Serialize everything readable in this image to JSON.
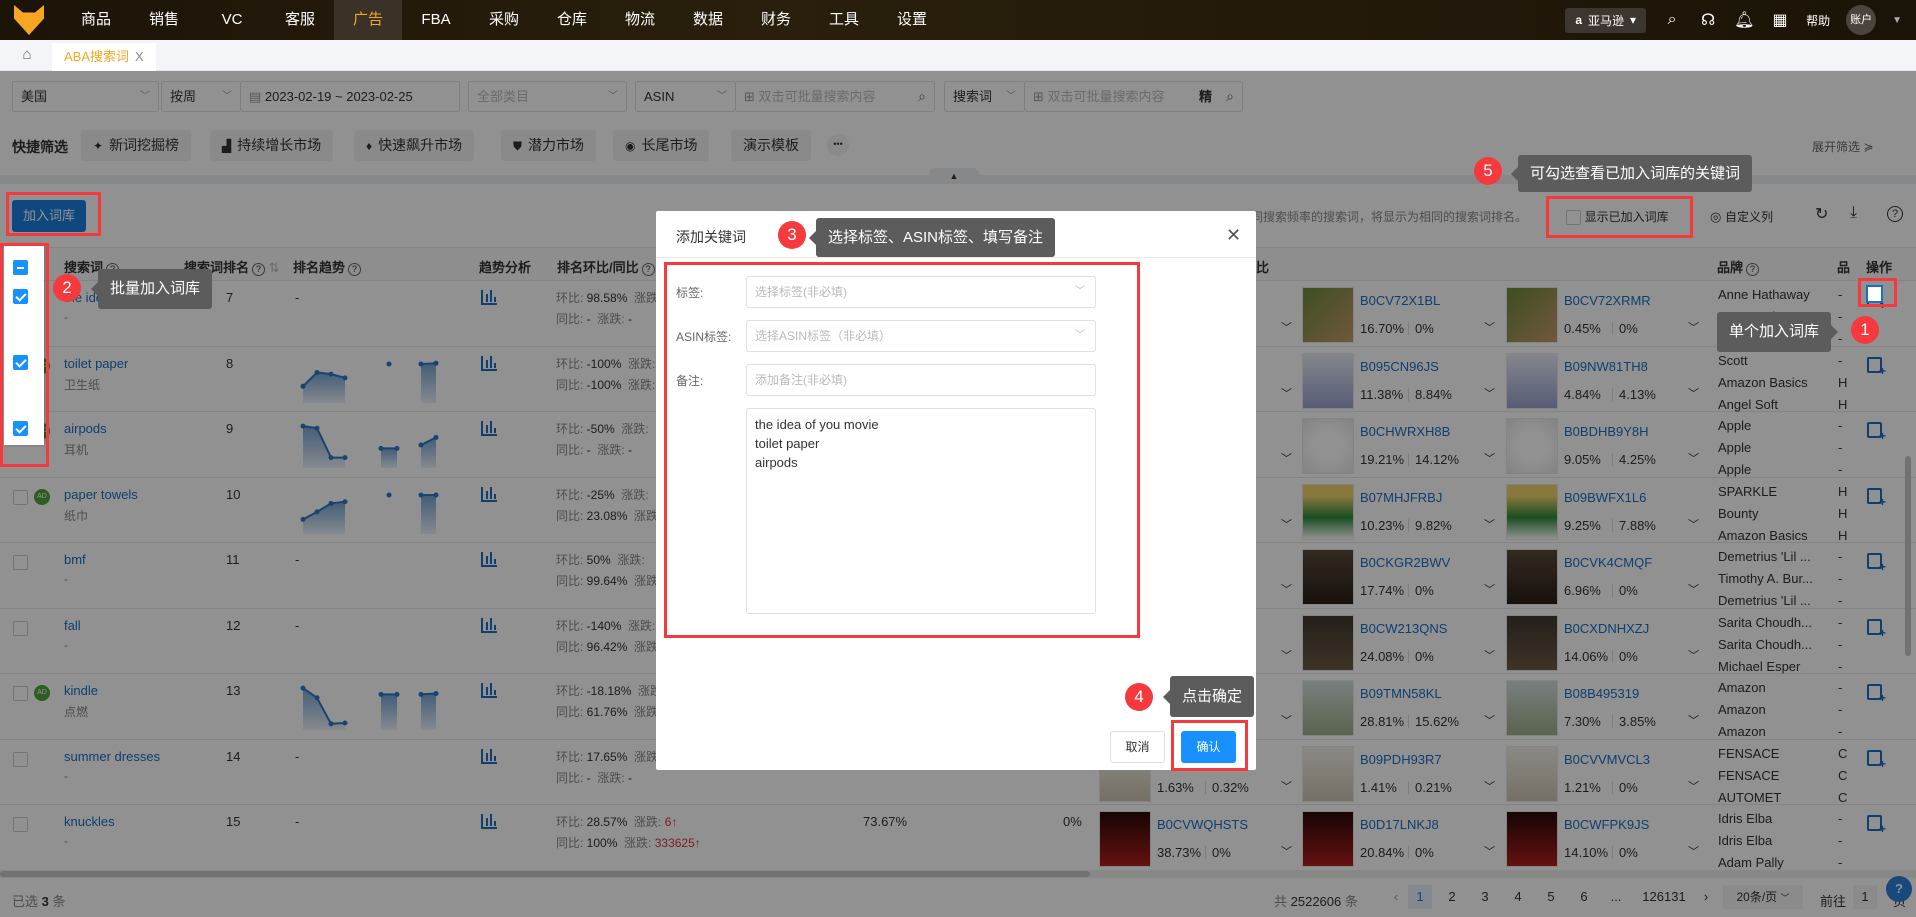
{
  "nav": {
    "items": [
      "商品",
      "销售",
      "VC",
      "客服",
      "广告",
      "FBA",
      "采购",
      "仓库",
      "物流",
      "数据",
      "财务",
      "工具",
      "设置"
    ],
    "active_index": 4,
    "marketplace": "亚马逊",
    "help": "帮助",
    "account": "账户"
  },
  "tabs": {
    "items": [
      {
        "label": "ABA搜索词",
        "close": "X"
      }
    ]
  },
  "filters": {
    "country": "美国",
    "period": "按周",
    "date_range": "2023-02-19 ~ 2023-02-25",
    "category_placeholder": "全部类目",
    "asin_type": "ASIN",
    "asin_search_placeholder": "双击可批量搜索内容",
    "term_type": "搜索词",
    "term_search_placeholder": "双击可批量搜索内容",
    "exact": "精"
  },
  "quick": {
    "label": "快捷筛选",
    "chips": [
      "新词挖掘榜",
      "持续增长市场",
      "快速飙升市场",
      "潜力市场",
      "长尾市场",
      "演示模板"
    ],
    "more": "•••",
    "expand": "展开筛选"
  },
  "toolbar": {
    "add_button": "加入词库",
    "note": "同搜索频率的搜索词，将显示为相同的搜索词排名。",
    "show_added": "显示已加入词库",
    "custom_columns": "自定义列"
  },
  "table": {
    "headers": {
      "term": "搜索词",
      "rank": "搜索词排名",
      "rank_trend": "排名趋势",
      "trend_analysis": "趋势分析",
      "rank_compare": "排名环比/同比",
      "hidden_col_tail": "比",
      "brand": "品牌",
      "category": "品",
      "actions": "操作"
    },
    "labels": {
      "mom": "环比: ",
      "yoy": "同比: ",
      "change": "涨跌: "
    },
    "rows": [
      {
        "term": "the idea of you movie",
        "term_cn": "-",
        "ad": false,
        "checked": true,
        "rank": "7",
        "trend": null,
        "mom": "98.58%",
        "mom_change": "",
        "yoy": "-",
        "yoy_change": "-",
        "extra": null,
        "asins": [
          null,
          {
            "code": "B0CV72X1BL",
            "p1": "16.70%",
            "p2": "0%"
          },
          {
            "code": "B0CV72XRMR",
            "p1": "0.45%",
            "p2": "0%"
          }
        ],
        "brands": [
          "Anne Hathaway",
          "Anne Hathaway",
          "Anne Hathaway"
        ],
        "cat": [
          "-",
          "-",
          "-"
        ]
      },
      {
        "term": "toilet paper",
        "term_cn": "卫生纸",
        "ad": true,
        "checked": true,
        "rank": "8",
        "trend": [
          [
            35,
            68,
            64,
            55
          ],
          [
            88
          ],
          [
            88,
            90
          ]
        ],
        "mom": "-100%",
        "mom_change": "",
        "yoy": "-100%",
        "yoy_change": "",
        "extra": null,
        "asins": [
          null,
          {
            "code": "B095CN96JS",
            "p1": "11.38%",
            "p2": "8.84%"
          },
          {
            "code": "B09NW81TH8",
            "p1": "4.84%",
            "p2": "4.13%"
          }
        ],
        "brands": [
          "Scott",
          "Amazon Basics",
          "Angel Soft"
        ],
        "cat": [
          "-",
          "H",
          "H"
        ]
      },
      {
        "term": "airpods",
        "term_cn": "耳机",
        "ad": true,
        "checked": true,
        "rank": "9",
        "trend": [
          [
            95,
            90,
            20,
            20
          ],
          [
            42,
            42
          ],
          [
            50,
            68
          ]
        ],
        "mom": "-50%",
        "mom_change": "",
        "yoy": "-",
        "yoy_change": "-",
        "extra": null,
        "asins": [
          null,
          {
            "code": "B0CHWRXH8B",
            "p1": "19.21%",
            "p2": "14.12%"
          },
          {
            "code": "B0BDHB9Y8H",
            "p1": "9.05%",
            "p2": "4.25%"
          }
        ],
        "brands": [
          "Apple",
          "Apple",
          "Apple"
        ],
        "cat": [
          "-",
          "-",
          "-"
        ]
      },
      {
        "term": "paper towels",
        "term_cn": "纸巾",
        "ad": true,
        "checked": false,
        "rank": "10",
        "trend": [
          [
            30,
            48,
            68,
            72
          ],
          [
            88
          ],
          [
            88,
            88
          ]
        ],
        "mom": "-25%",
        "mom_change": "",
        "yoy": "23.08%",
        "yoy_change": "",
        "extra": null,
        "asins": [
          null,
          {
            "code": "B07MHJFRBJ",
            "p1": "10.23%",
            "p2": "9.82%"
          },
          {
            "code": "B09BWFX1L6",
            "p1": "9.25%",
            "p2": "7.88%"
          }
        ],
        "brands": [
          "SPARKLE",
          "Bounty",
          "Amazon Basics"
        ],
        "cat": [
          "H",
          "H",
          "H"
        ]
      },
      {
        "term": "bmf",
        "term_cn": "-",
        "ad": false,
        "checked": false,
        "rank": "11",
        "trend": null,
        "mom": "50%",
        "mom_change": "",
        "yoy": "99.64%",
        "yoy_change": "",
        "extra": null,
        "asins": [
          null,
          {
            "code": "B0CKGR2BWV",
            "p1": "17.74%",
            "p2": "0%"
          },
          {
            "code": "B0CVK4CMQF",
            "p1": "6.96%",
            "p2": "0%"
          }
        ],
        "brands": [
          "Demetrius 'Lil ...",
          "Timothy A. Bur...",
          "Demetrius 'Lil ..."
        ],
        "cat": [
          "-",
          "-",
          "-"
        ]
      },
      {
        "term": "fall",
        "term_cn": "-",
        "ad": false,
        "checked": false,
        "rank": "12",
        "trend": null,
        "mom": "-140%",
        "mom_change": "",
        "yoy": "96.42%",
        "yoy_change": "",
        "extra": null,
        "asins": [
          null,
          {
            "code": "B0CW213QNS",
            "p1": "24.08%",
            "p2": "0%"
          },
          {
            "code": "B0CXDNHXZJ",
            "p1": "14.06%",
            "p2": "0%"
          }
        ],
        "brands": [
          "Sarita Choudh...",
          "Sarita Choudh...",
          "Michael Esper"
        ],
        "cat": [
          "-",
          "-",
          "-"
        ]
      },
      {
        "term": "kindle",
        "term_cn": "点燃",
        "ad": true,
        "checked": false,
        "rank": "13",
        "trend": [
          [
            95,
            72,
            10,
            12
          ],
          [
            80,
            80
          ],
          [
            80,
            82
          ]
        ],
        "mom": "-18.18%",
        "mom_change": "",
        "yoy": "61.76%",
        "yoy_change": "",
        "extra": null,
        "asins": [
          null,
          {
            "code": "B09TMN58KL",
            "p1": "28.81%",
            "p2": "15.62%"
          },
          {
            "code": "B08B495319",
            "p1": "7.30%",
            "p2": "3.85%"
          }
        ],
        "brands": [
          "Amazon",
          "Amazon",
          "Amazon"
        ],
        "cat": [
          "-",
          "-",
          "-"
        ]
      },
      {
        "term": "summer dresses",
        "term_cn": "-",
        "ad": false,
        "checked": false,
        "rank": "14",
        "trend": null,
        "mom": "17.65%",
        "mom_change": "",
        "yoy": "-",
        "yoy_change": "-",
        "extra": null,
        "asins": [
          {
            "code": "",
            "p1": "1.63%",
            "p2": "0.32%"
          },
          {
            "code": "B09PDH93R7",
            "p1": "1.41%",
            "p2": "0.21%"
          },
          {
            "code": "B0CVVMVCL3",
            "p1": "1.21%",
            "p2": "0%"
          }
        ],
        "brands": [
          "FENSACE",
          "FENSACE",
          "AUTOMET"
        ],
        "cat": [
          "C",
          "C",
          "C"
        ]
      },
      {
        "term": "knuckles",
        "term_cn": "-",
        "ad": false,
        "checked": false,
        "rank": "15",
        "trend": null,
        "mom": "28.57%",
        "mom_change": "6↑",
        "yoy": "100%",
        "yoy_change": "333625↑",
        "extra": {
          "a": "73.67%",
          "b": "0%"
        },
        "asins": [
          {
            "code": "B0CVWQHSTS",
            "p1": "38.73%",
            "p2": "0%"
          },
          {
            "code": "B0D17LNKJ8",
            "p1": "20.84%",
            "p2": "0%"
          },
          {
            "code": "B0CWFPK9JS",
            "p1": "14.10%",
            "p2": "0%"
          }
        ],
        "brands": [
          "Idris Elba",
          "Idris Elba",
          "Adam Pally"
        ],
        "cat": [
          "-",
          "-",
          "-"
        ]
      }
    ]
  },
  "footer": {
    "selected_prefix": "已选",
    "selected_count": "3",
    "selected_suffix": "条",
    "total_prefix": "共",
    "total": "2522606",
    "total_suffix": "条",
    "prev": "‹",
    "next": "›",
    "pages": [
      "1",
      "2",
      "3",
      "4",
      "5",
      "6"
    ],
    "current_page": "1",
    "ellipsis": "...",
    "last_page": "126131",
    "page_size": "20条/页",
    "goto_label": "前往",
    "goto_value": "1",
    "goto_suffix": "页"
  },
  "dialog": {
    "title": "添加关键词",
    "tag_label": "标签:",
    "tag_placeholder": "选择标签(非必填)",
    "asin_tag_label": "ASIN标签:",
    "asin_tag_placeholder": "选择ASIN标签（非必填）",
    "note_label": "备注:",
    "note_placeholder": "添加备注(非必填)",
    "keywords": "the idea of you movie\ntoilet paper\nairpods",
    "cancel": "取消",
    "confirm": "确认"
  },
  "annotations": [
    {
      "step": "1",
      "text": "单个加入词库"
    },
    {
      "step": "2",
      "text": "批量加入词库"
    },
    {
      "step": "3",
      "text": "选择标签、ASIN标签、填写备注"
    },
    {
      "step": "4",
      "text": "点击确定"
    },
    {
      "step": "5",
      "text": "可勾选查看已加入词库的关键词"
    }
  ],
  "colors": {
    "accent": "#f6a623",
    "primary": "#1890ff",
    "annotation": "#f5393c",
    "link": "#1a6fc4"
  }
}
